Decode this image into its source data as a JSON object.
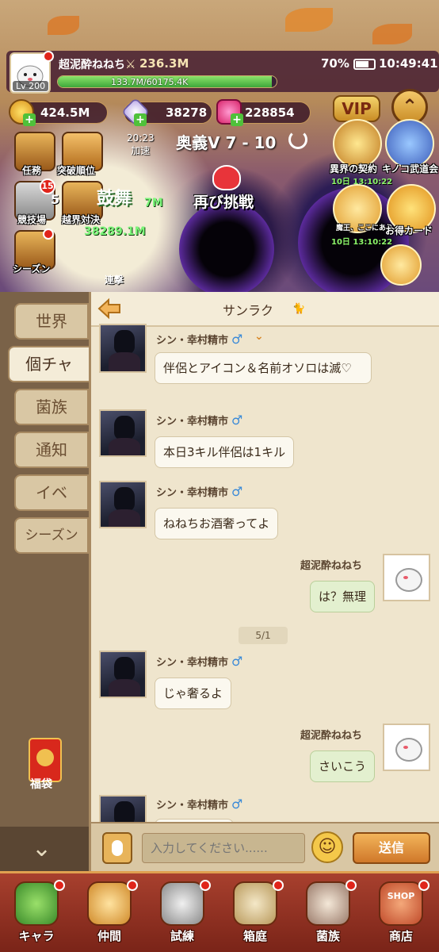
{
  "player": {
    "name": "超泥酔ねねち",
    "level": "Lv 200",
    "power": "236.3M",
    "xp_text": "133.7M/60175.4K",
    "xp_progress": 0.98
  },
  "status_bar": {
    "battery": "70%",
    "time": "10:49:41"
  },
  "currencies": {
    "gold": "424.5M",
    "diamond": "38278",
    "gem": "228854"
  },
  "vip_label": "VIP",
  "up_arrow": "⌃",
  "left_menu": {
    "task": "任務",
    "breakthrough": "突破順位",
    "arena": "競技場",
    "arena_badge": "15",
    "crossrealm": "越界対決",
    "season": "シーズン"
  },
  "speed": {
    "time": "20:23",
    "label": "加速"
  },
  "stage": "奥義Ⅴ 7 - 10",
  "retry_label": "再び挑戦",
  "battle_text": {
    "dance": "鼓舞",
    "dmg1": "7M",
    "dmg2": "38289.1M",
    "dmg3": "5",
    "combo": "連撃"
  },
  "events": [
    {
      "label": "異界の契約",
      "date": "10日 13:10:22"
    },
    {
      "label": "キノコ武道会",
      "date": ""
    },
    {
      "label": "魔王、ここにあり！",
      "date": "10日 13:10:22"
    },
    {
      "label": "お得カード",
      "date": ""
    }
  ],
  "chat": {
    "title": "サンラク",
    "back_icon": "back-arrow-icon",
    "tabs": [
      "世界",
      "個チャ",
      "菌族",
      "通知",
      "イベ",
      "シーズン"
    ],
    "active_tab": 1,
    "fukubukuro_label": "福袋",
    "date_divider": "5/1",
    "messages": [
      {
        "sender": "シン・幸村精市",
        "gender": "♂",
        "text": "伴侶とアイコン＆名前オソロは滅♡",
        "self": false
      },
      {
        "sender": "シン・幸村精市",
        "gender": "♂",
        "text": "本日3キル伴侶は1キル",
        "self": false
      },
      {
        "sender": "シン・幸村精市",
        "gender": "♂",
        "text": "ねねちお酒奢ってよ",
        "self": false
      },
      {
        "sender": "超泥酔ねねち",
        "gender": "",
        "text": "は？無理",
        "self": true
      },
      {
        "sender": "シン・幸村精市",
        "gender": "♂",
        "text": "じゃ奢るよ",
        "self": false
      },
      {
        "sender": "超泥酔ねねち",
        "gender": "",
        "text": "さいこう",
        "self": true
      },
      {
        "sender": "シン・幸村精市",
        "gender": "♂",
        "text": "",
        "self": false
      }
    ],
    "input_placeholder": "入力してください......",
    "send_label": "送信"
  },
  "bottom_nav": [
    {
      "label": "キャラ",
      "badge": true
    },
    {
      "label": "仲間",
      "badge": true
    },
    {
      "label": "試練",
      "badge": true
    },
    {
      "label": "箱庭",
      "badge": true
    },
    {
      "label": "菌族",
      "badge": true
    },
    {
      "label": "商店",
      "badge": true
    }
  ],
  "shop_badge": "SHOP"
}
